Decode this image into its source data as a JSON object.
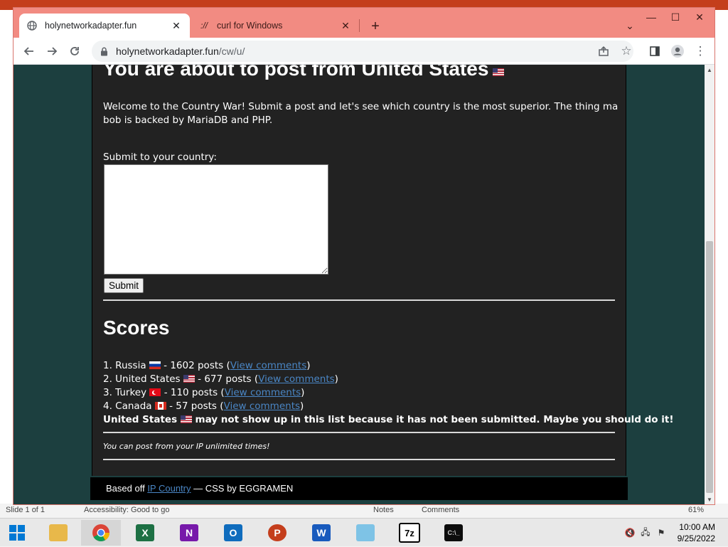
{
  "browser": {
    "tabs": [
      {
        "title": "holynetworkadapter.fun",
        "icon": "globe-icon"
      },
      {
        "title": "curl for Windows",
        "icon": "curl-icon"
      }
    ],
    "url_host": "holynetworkadapter.fun",
    "url_path": "/cw/u/"
  },
  "page": {
    "heading": "You are about to post from United States",
    "intro": "Welcome to the Country War! Submit a post and let's see which country is the most superior. The thing ma bob is backed by MariaDB and PHP.",
    "submit_label": "Submit to your country:",
    "submit_button": "Submit",
    "textarea_value": "",
    "scores_heading": "Scores",
    "scores": [
      {
        "prefix": "1. Russia",
        "flag": "ru",
        "count": " - 1602 posts (",
        "link": "View comments",
        "suffix": ")"
      },
      {
        "prefix": "2. United States",
        "flag": "us",
        "count": " - 677 posts (",
        "link": "View comments",
        "suffix": ")"
      },
      {
        "prefix": "3. Turkey",
        "flag": "tr",
        "count": " - 110 posts (",
        "link": "View comments",
        "suffix": ")"
      },
      {
        "prefix": "4. Canada",
        "flag": "ca",
        "count": " - 57 posts (",
        "link": "View comments",
        "suffix": ")"
      }
    ],
    "notice_country": "United States",
    "notice_rest": " may not show up in this list because it has not been submitted. Maybe you should do it!",
    "unlimited_note": "You can post from your IP unlimited times!",
    "footer_prefix": "Based off ",
    "footer_link": "IP Country",
    "footer_suffix": " — CSS by EGGRAMEN"
  },
  "app_statusbar": {
    "slide": "Slide 1 of 1",
    "accessibility": "Accessibility: Good to go",
    "notes": "Notes",
    "comments": "Comments",
    "zoom": "61%"
  },
  "taskbar": {
    "apps": [
      "file-explorer",
      "chrome",
      "excel",
      "onenote",
      "outlook",
      "powerpoint",
      "word",
      "notepad",
      "7zip",
      "cmd"
    ],
    "time": "10:00 AM",
    "date": "9/25/2022"
  },
  "colors": {
    "tabstrip": "#f28b82",
    "page_bg": "#1c3f3f",
    "panel_bg": "#222222",
    "link": "#4a86c5"
  }
}
